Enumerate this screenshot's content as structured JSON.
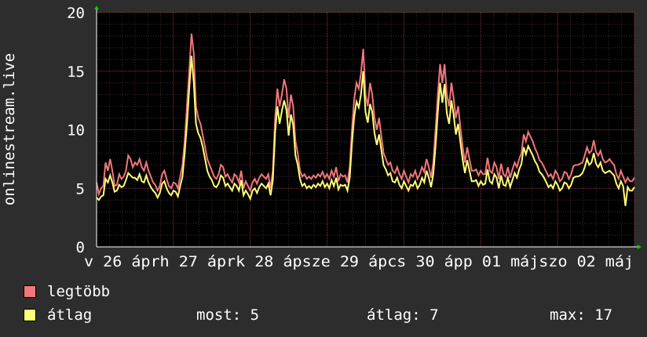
{
  "chart_data": {
    "type": "area",
    "ylabel": "onlinestream.live",
    "ylim": [
      0,
      20
    ],
    "y_ticks": [
      "0",
      "5",
      "10",
      "15",
      "20"
    ],
    "x_tick_labels": [
      "v 26 áprh 27 áprk 28 ápsze 29 ápcs 30 ápp 01 májszo 02 máj"
    ],
    "grid": true,
    "colors": {
      "max": "#f0777c",
      "avg": "#ffff77",
      "background": "#000000",
      "page": "#2d2d2d"
    },
    "series": [
      {
        "name": "legtöbb",
        "values": [
          5.5,
          4.5,
          5,
          5.2,
          7.2,
          6.5,
          7.5,
          6.5,
          5.2,
          5.3,
          6.2,
          5.8,
          6,
          6.5,
          7.8,
          7.5,
          6.8,
          7.2,
          7,
          7.5,
          6.8,
          6.5,
          7.2,
          6.5,
          6,
          5.5,
          5.3,
          4.8,
          5.2,
          6.2,
          6.5,
          5.8,
          5.2,
          5,
          5.5,
          5.4,
          5,
          6,
          7,
          9,
          12,
          15,
          18.2,
          16.5,
          12,
          11,
          10.5,
          9.5,
          8.5,
          7.5,
          7,
          6.5,
          6,
          5.8,
          6.2,
          7,
          6.8,
          6,
          6.2,
          5.8,
          5.5,
          6.2,
          6,
          5.5,
          6.5,
          5,
          5.6,
          5.2,
          4.8,
          5.5,
          5.8,
          5.4,
          5.9,
          6.2,
          6,
          5.8,
          6.2,
          5,
          6.5,
          11,
          13.5,
          12,
          13,
          14.3,
          13.5,
          11,
          13,
          12,
          9,
          8,
          6.5,
          6,
          6.2,
          5.8,
          6,
          5.8,
          6.1,
          5.9,
          6.2,
          6,
          6.4,
          5.9,
          6.2,
          5.8,
          6.5,
          6,
          6.8,
          5.6,
          6.2,
          6,
          6.1,
          5.5,
          6.8,
          10,
          12.6,
          14,
          13.5,
          14.8,
          16.9,
          13,
          12,
          14,
          13,
          11,
          10,
          11,
          9.5,
          8,
          7.5,
          7,
          7.2,
          6.5,
          6.3,
          6.8,
          6.2,
          5.8,
          6.5,
          6,
          5.5,
          6.2,
          6,
          6.5,
          5.8,
          6.2,
          6.8,
          6.4,
          7.5,
          6.8,
          5.9,
          7.2,
          10,
          13,
          15.6,
          14,
          15.6,
          13,
          12,
          14,
          12.7,
          11,
          12,
          10.2,
          8.5,
          7.2,
          8.5,
          7.5,
          6.5,
          6.5,
          6.6,
          6.1,
          6.5,
          6.2,
          6.2,
          7.6,
          6.5,
          6.3,
          7.2,
          6.8,
          5.8,
          7.1,
          6.2,
          6,
          6.8,
          5.9,
          6.6,
          7.2,
          6.8,
          7.5,
          8,
          9.6,
          9,
          9.8,
          9.4,
          9,
          8.4,
          8,
          7.4,
          7.2,
          6.8,
          6.4,
          6,
          6.2,
          5.8,
          6.5,
          6.2,
          5.6,
          5.8,
          6.4,
          6.3,
          5.8,
          6.2,
          6.9,
          7,
          7,
          7.1,
          7.2,
          7.8,
          8.5,
          8,
          8.2,
          9.1,
          8.1,
          7.8,
          8.2,
          7.5,
          7.2,
          7.3,
          7.5,
          7.2,
          7,
          6.2,
          5.8,
          6.5,
          6,
          5.5,
          5.9,
          5.6,
          5.6,
          5.9
        ]
      },
      {
        "name": "átlag",
        "values": [
          4.2,
          4,
          4.3,
          4.4,
          5.8,
          5.5,
          6.1,
          5.5,
          4.7,
          4.8,
          5.3,
          5.1,
          5.2,
          5.7,
          6.3,
          6.1,
          5.9,
          5.9,
          5.7,
          6.2,
          5.6,
          5.5,
          6.1,
          5.5,
          5.1,
          4.8,
          4.6,
          4.2,
          4.6,
          5.4,
          5.6,
          5,
          4.6,
          4.4,
          4.8,
          4.7,
          4.3,
          5.2,
          6,
          8,
          10.5,
          13.5,
          16.3,
          14,
          10.5,
          9.7,
          9.3,
          8.5,
          7.5,
          6.5,
          6,
          5.7,
          5.2,
          5.1,
          5.4,
          6.1,
          5.9,
          5.2,
          5.4,
          5.1,
          4.8,
          5.4,
          5.2,
          4.8,
          5.7,
          4.4,
          4.8,
          4.5,
          4.1,
          4.8,
          5,
          4.6,
          5.1,
          5.4,
          5.2,
          5,
          5.4,
          4.4,
          5.7,
          9.8,
          12,
          10.5,
          11.6,
          12.5,
          11.7,
          9.5,
          11.3,
          10.4,
          7.8,
          7,
          5.8,
          5.2,
          5.4,
          5,
          5.2,
          5,
          5.3,
          5.1,
          5.4,
          5.2,
          5.6,
          5.1,
          5.4,
          5,
          5.7,
          5.2,
          5.9,
          4.9,
          5.3,
          5.2,
          5.3,
          4.8,
          5.9,
          8.8,
          11.1,
          12.4,
          11.9,
          13,
          15,
          11.5,
          10.6,
          12.2,
          11.5,
          9.7,
          8.7,
          9.6,
          8.3,
          7,
          6.6,
          6.1,
          6.3,
          5.6,
          5.5,
          5.9,
          5.3,
          5,
          5.6,
          5.2,
          4.8,
          5.3,
          5.2,
          5.6,
          5,
          5.3,
          5.9,
          5.5,
          6.5,
          5.9,
          5.1,
          6.2,
          8.6,
          11.5,
          14,
          12.3,
          13.9,
          11.4,
          10.5,
          12.5,
          11.3,
          9.6,
          10.5,
          8.9,
          7.4,
          6.3,
          7.4,
          6.5,
          5.6,
          5.6,
          5.7,
          5.2,
          5.6,
          5.3,
          5.4,
          6.6,
          5.6,
          5.4,
          6.2,
          5.9,
          5,
          6.1,
          5.3,
          5.2,
          5.9,
          5.1,
          5.7,
          6.3,
          5.9,
          6.6,
          7.1,
          8.5,
          7.9,
          8.6,
          8.2,
          7.8,
          7.3,
          7,
          6.4,
          6.2,
          5.9,
          5.5,
          5.1,
          5.3,
          5,
          5.6,
          5.3,
          4.8,
          5,
          5.5,
          5.4,
          5,
          5.3,
          5.9,
          6,
          6,
          6.1,
          6.3,
          6.8,
          7.5,
          7,
          7.2,
          8,
          7.1,
          6.8,
          7.2,
          6.5,
          6.3,
          6.4,
          6.5,
          6.3,
          6.1,
          5.4,
          5,
          5.6,
          5.2,
          3.5,
          5.1,
          4.8,
          4.8,
          5.1
        ]
      }
    ]
  },
  "legend": {
    "max_label": "legtöbb",
    "avg_label": "átlag",
    "stat_now": "most: 5",
    "stat_avg": "átlag: 7",
    "stat_max": "max: 17"
  }
}
